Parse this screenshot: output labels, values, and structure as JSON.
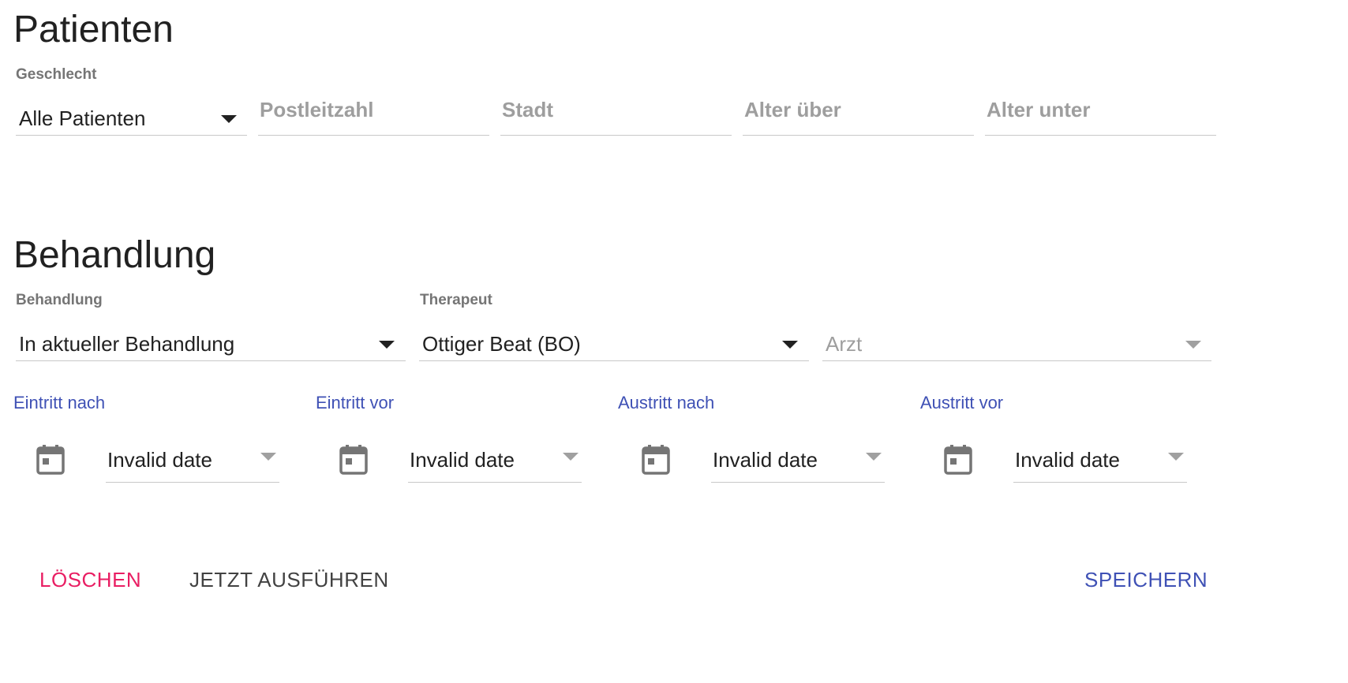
{
  "patients": {
    "title": "Patienten",
    "gender_label": "Geschlecht",
    "gender_value": "Alle Patienten",
    "zip_placeholder": "Postleitzahl",
    "city_placeholder": "Stadt",
    "age_over_placeholder": "Alter über",
    "age_under_placeholder": "Alter unter"
  },
  "treatment": {
    "title": "Behandlung",
    "treatment_label": "Behandlung",
    "treatment_value": "In aktueller Behandlung",
    "therapist_label": "Therapeut",
    "therapist_value": "Ottiger Beat (BO)",
    "doctor_placeholder": "Arzt"
  },
  "dates": [
    {
      "label": "Eintritt nach",
      "value": "Invalid date"
    },
    {
      "label": "Eintritt vor",
      "value": "Invalid date"
    },
    {
      "label": "Austritt nach",
      "value": "Invalid date"
    },
    {
      "label": "Austritt vor",
      "value": "Invalid date"
    }
  ],
  "actions": {
    "delete_label": "LÖSCHEN",
    "run_label": "JETZT AUSFÜHREN",
    "save_label": "SPEICHERN"
  },
  "colors": {
    "accent": "#3f51b5",
    "danger": "#e91e63",
    "text": "#212121",
    "secondary": "#757575"
  }
}
